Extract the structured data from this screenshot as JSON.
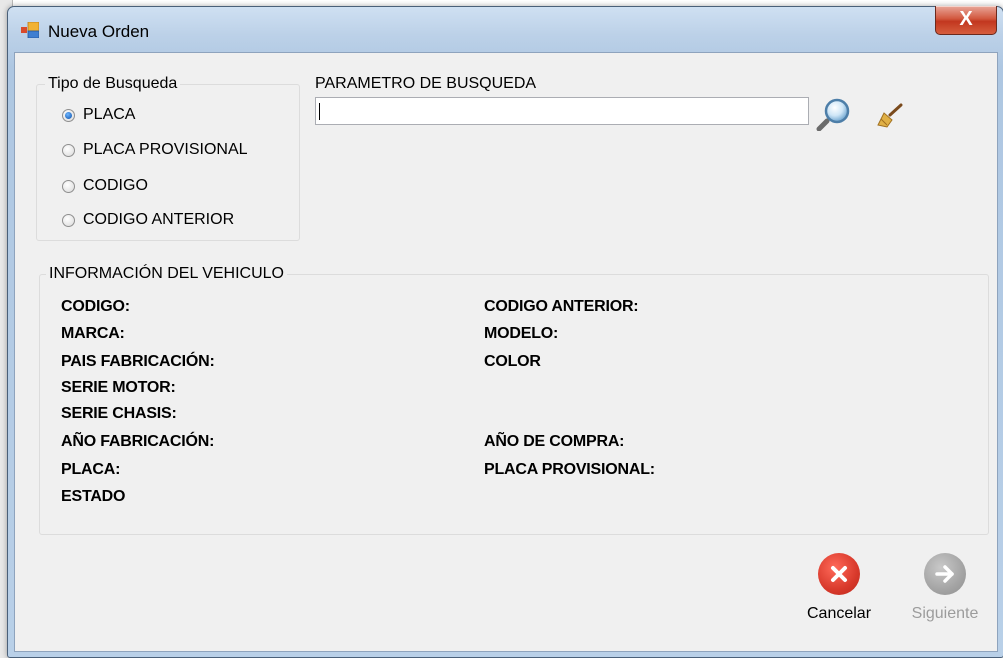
{
  "window": {
    "title": "Nueva Orden",
    "close_label": "X"
  },
  "search": {
    "group_title": "Tipo de Busqueda",
    "options": [
      {
        "label": "PLACA",
        "checked": true
      },
      {
        "label": "PLACA PROVISIONAL",
        "checked": false
      },
      {
        "label": "CODIGO",
        "checked": false
      },
      {
        "label": "CODIGO ANTERIOR",
        "checked": false
      }
    ],
    "param_label": "PARAMETRO DE BUSQUEDA",
    "param_value": ""
  },
  "info": {
    "group_title": "INFORMACIÓN DEL VEHICULO",
    "left": [
      "CODIGO:",
      "MARCA:",
      "PAIS FABRICACIÓN:",
      "SERIE MOTOR:",
      "SERIE CHASIS:",
      "AÑO FABRICACIÓN:",
      "PLACA:",
      "ESTADO"
    ],
    "right": [
      "CODIGO ANTERIOR:",
      "MODELO:",
      "COLOR",
      "AÑO DE COMPRA:",
      "PLACA PROVISIONAL:"
    ]
  },
  "actions": {
    "cancel_label": "Cancelar",
    "next_label": "Siguiente"
  },
  "colors": {
    "cancel": "#d8392b",
    "next_disabled": "#a4a4a4",
    "title_bar": "#bcd1e8"
  },
  "icons": {
    "search": "magnifier-icon",
    "clear": "broom-icon",
    "cancel": "x-circle-icon",
    "next": "arrow-right-circle-icon",
    "app": "form-icon"
  }
}
